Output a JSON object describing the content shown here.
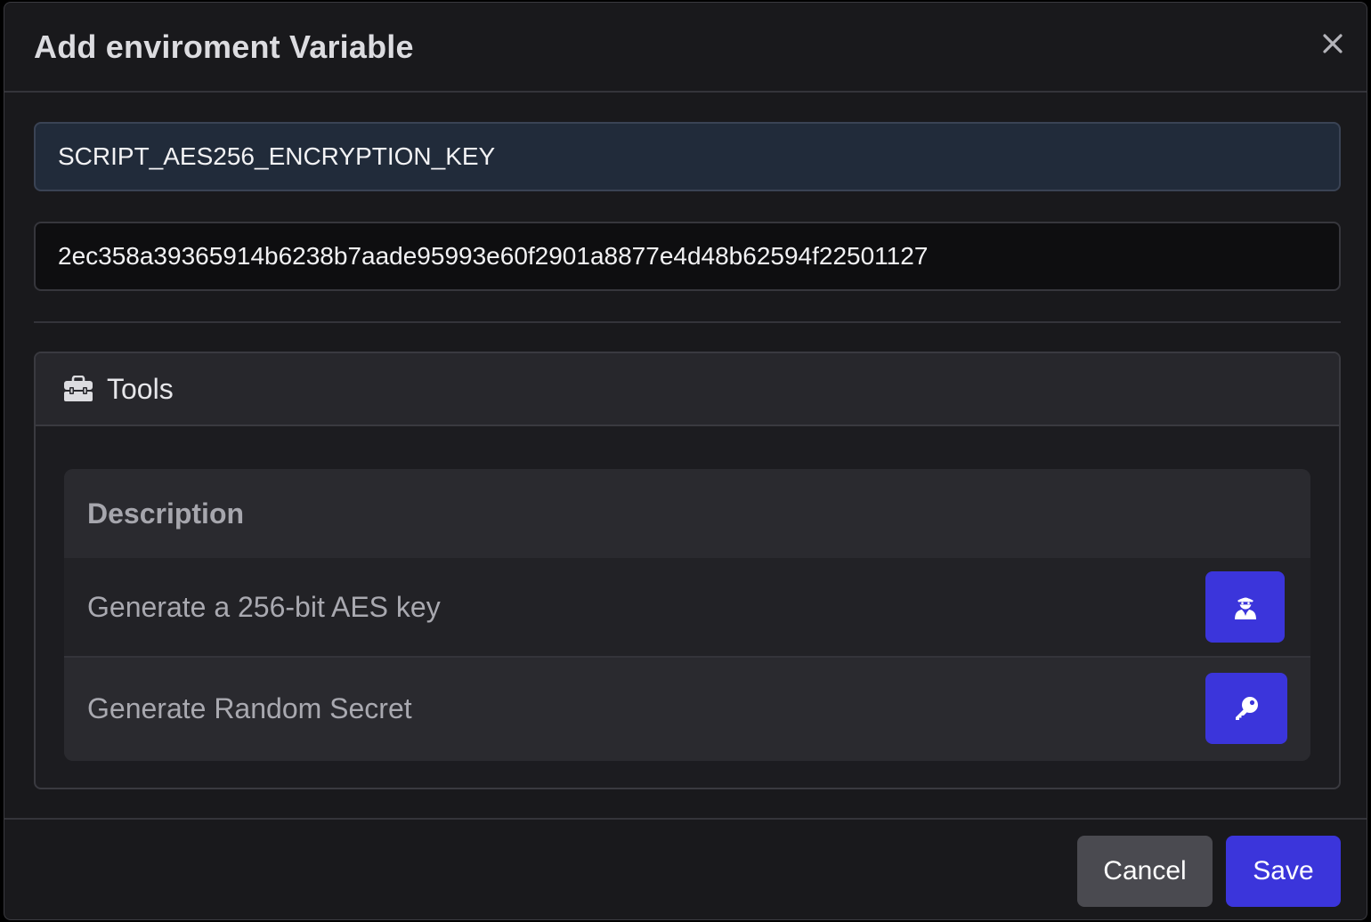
{
  "dialog": {
    "title": "Add enviroment Variable"
  },
  "form": {
    "name_value": "SCRIPT_AES256_ENCRYPTION_KEY",
    "secret_value": "2ec358a39365914b6238b7aade95993e60f2901a8877e4d48b62594f22501127"
  },
  "tools": {
    "title": "Tools",
    "header_icon": "toolbox-icon",
    "table_header": "Description",
    "rows": [
      {
        "label": "Generate a 256-bit AES key",
        "icon": "user-secret-icon"
      },
      {
        "label": "Generate Random Secret",
        "icon": "key-icon"
      }
    ]
  },
  "footer": {
    "cancel_label": "Cancel",
    "save_label": "Save"
  },
  "colors": {
    "accent": "#3b35db",
    "background": "#19191c",
    "name_field_bg": "#212b3a"
  }
}
